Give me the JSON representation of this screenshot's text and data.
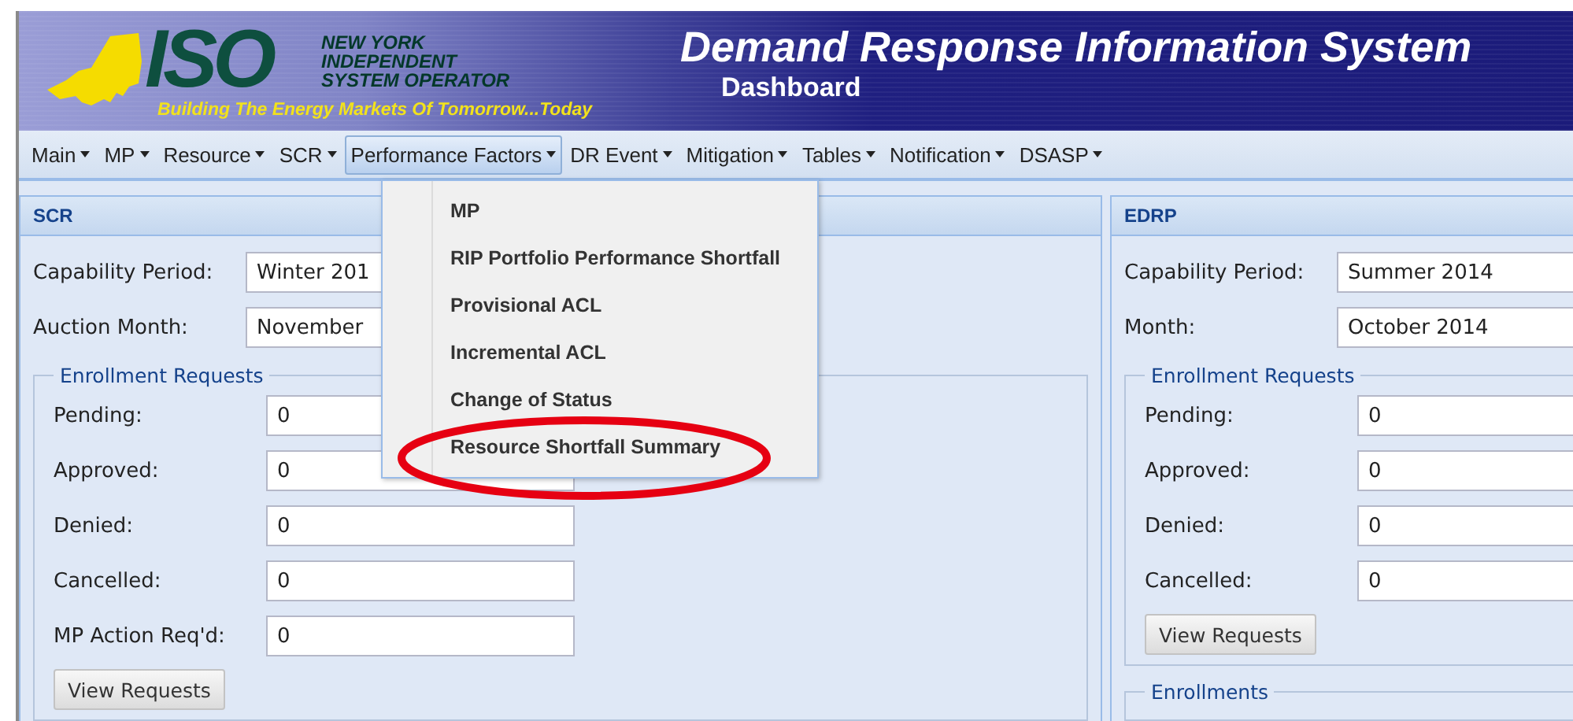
{
  "header": {
    "logo": {
      "letters": "ISO",
      "name_lines": [
        "NEW YORK",
        "INDEPENDENT",
        "SYSTEM OPERATOR"
      ],
      "tagline": "Building The Energy Markets Of Tomorrow...Today"
    },
    "title": "Demand Response Information System",
    "subtitle": "Dashboard"
  },
  "menu": [
    {
      "label": "Main",
      "selected": false
    },
    {
      "label": "MP",
      "selected": false
    },
    {
      "label": "Resource",
      "selected": false
    },
    {
      "label": "SCR",
      "selected": false
    },
    {
      "label": "Performance Factors",
      "selected": true
    },
    {
      "label": "DR Event",
      "selected": false
    },
    {
      "label": "Mitigation",
      "selected": false
    },
    {
      "label": "Tables",
      "selected": false
    },
    {
      "label": "Notification",
      "selected": false
    },
    {
      "label": "DSASP",
      "selected": false
    }
  ],
  "open_menu": {
    "items": [
      {
        "label": "MP",
        "circled": false
      },
      {
        "label": "RIP Portfolio Performance Shortfall",
        "circled": false
      },
      {
        "label": "Provisional ACL",
        "circled": false
      },
      {
        "label": "Incremental ACL",
        "circled": false
      },
      {
        "label": "Change of Status",
        "circled": false
      },
      {
        "label": "Resource Shortfall Summary",
        "circled": true
      }
    ]
  },
  "panels": [
    {
      "title": "SCR",
      "fields": [
        {
          "label": "Capability Period:",
          "value": "Winter 201"
        },
        {
          "label": "Auction Month:",
          "value": "November"
        }
      ],
      "groups": [
        {
          "legend": "Enrollment Requests",
          "rows": [
            {
              "label": "Pending:",
              "value": "0"
            },
            {
              "label": "Approved:",
              "value": "0"
            },
            {
              "label": "Denied:",
              "value": "0"
            },
            {
              "label": "Cancelled:",
              "value": "0"
            },
            {
              "label": "MP Action Req'd:",
              "value": "0"
            }
          ],
          "button": "View Requests"
        }
      ]
    },
    {
      "title": "EDRP",
      "fields": [
        {
          "label": "Capability Period:",
          "value": "Summer 2014"
        },
        {
          "label": "Month:",
          "value": "October 2014"
        }
      ],
      "groups": [
        {
          "legend": "Enrollment Requests",
          "rows": [
            {
              "label": "Pending:",
              "value": "0"
            },
            {
              "label": "Approved:",
              "value": "0"
            },
            {
              "label": "Denied:",
              "value": "0"
            },
            {
              "label": "Cancelled:",
              "value": "0"
            }
          ],
          "button": "View Requests"
        },
        {
          "legend": "Enrollments"
        }
      ]
    }
  ]
}
